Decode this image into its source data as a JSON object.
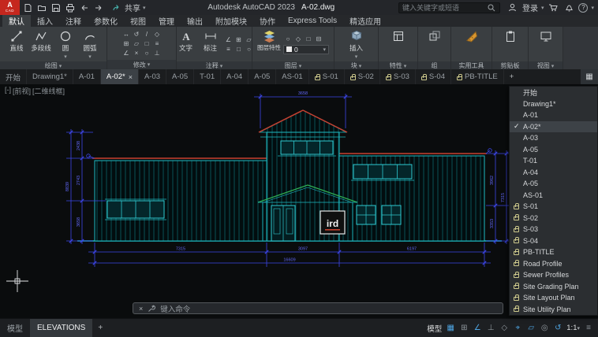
{
  "titlebar": {
    "share": "共享",
    "app_title": "Autodesk AutoCAD 2023",
    "doc_name": "A-02.dwg",
    "search_placeholder": "键入关键字或短语",
    "sign_in": "登录"
  },
  "ribbon_tabs": [
    "默认",
    "插入",
    "注释",
    "参数化",
    "视图",
    "管理",
    "输出",
    "附加模块",
    "协作",
    "Express Tools",
    "精选应用"
  ],
  "ribbon": {
    "draw": {
      "label": "绘图",
      "line": "直线",
      "polyline": "多段线",
      "circle": "圆",
      "arc": "圆弧"
    },
    "modify": {
      "label": "修改"
    },
    "annotate": {
      "label": "注释",
      "text": "文字",
      "dim": "标注"
    },
    "layers": {
      "label": "图层",
      "properties": "图层特性",
      "current_layer": "0"
    },
    "block": {
      "label": "块",
      "insert": "插入"
    },
    "props": {
      "label": "特性"
    },
    "groups": {
      "label": "组"
    },
    "utilities": {
      "label": "实用工具"
    },
    "clipboard": {
      "label": "剪贴板"
    },
    "view": {
      "label": "视图"
    }
  },
  "file_tabs": [
    "开始",
    "Drawing1*",
    "A-01",
    "A-02*",
    "A-03",
    "A-05",
    "T-01",
    "A-04",
    "A-05",
    "AS-01",
    "S-01",
    "S-02",
    "S-03",
    "S-04",
    "PB-TITLE"
  ],
  "overflow": [
    "开始",
    "Drawing1*",
    "A-01",
    "A-02*",
    "A-03",
    "A-05",
    "T-01",
    "A-04",
    "A-05",
    "AS-01",
    "S-01",
    "S-02",
    "S-03",
    "S-04",
    "PB-TITLE",
    "Road Profile",
    "Sewer Profiles",
    "Site Grading Plan",
    "Site Layout Plan",
    "Site Utility Plan"
  ],
  "canvas": {
    "vp_min": "[-]",
    "vp_view": "[前视]",
    "vp_style": "[二维线框]",
    "command_placeholder": "键入命令"
  },
  "drawing": {
    "sign": "ird",
    "dims": {
      "top": "3658",
      "left_a": "2438",
      "left_b": "2743",
      "left_c": "3658",
      "left_total": "8839",
      "right_a": "3962",
      "right_b": "3353",
      "right_total": "7315",
      "bottom_a": "7315",
      "bottom_b": "3097",
      "bottom_c": "6197",
      "bottom_total": "16609"
    }
  },
  "statusbar": {
    "model_tab": "模型",
    "layout_tab": "ELEVATIONS",
    "space_toggle": "模型",
    "scale": "1:1"
  }
}
